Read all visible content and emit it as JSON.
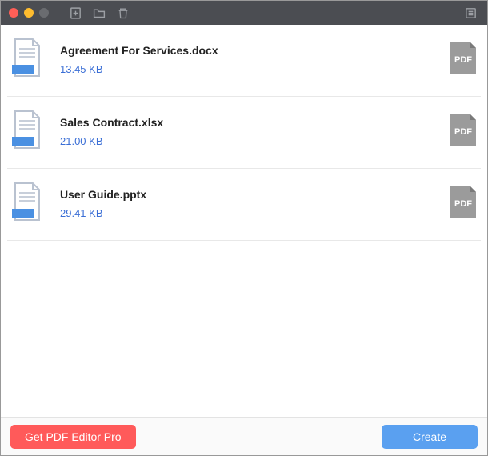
{
  "toolbar": {
    "icons": [
      "add-page-icon",
      "folder-icon",
      "trash-icon",
      "list-icon"
    ]
  },
  "files": [
    {
      "name": "Agreement For Services.docx",
      "size": "13.45 KB",
      "out": "PDF"
    },
    {
      "name": "Sales Contract.xlsx",
      "size": "21.00 KB",
      "out": "PDF"
    },
    {
      "name": "User Guide.pptx",
      "size": "29.41 KB",
      "out": "PDF"
    }
  ],
  "footer": {
    "pro_label": "Get PDF Editor Pro",
    "create_label": "Create"
  }
}
